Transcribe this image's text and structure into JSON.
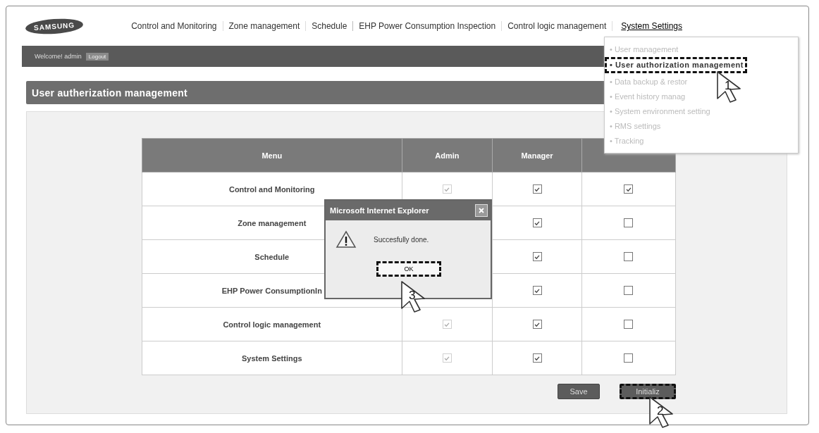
{
  "header": {
    "logo": "SAMSUNG",
    "nav": [
      {
        "label": "Control and Monitoring"
      },
      {
        "label": "Zone management"
      },
      {
        "label": "Schedule"
      },
      {
        "label": "EHP Power Consumption Inspection"
      },
      {
        "label": "Control logic management"
      },
      {
        "label": "System Settings",
        "expanded": true
      }
    ]
  },
  "user_bar": {
    "welcome": "Welcome! admin",
    "logout": "Logout"
  },
  "page_title": "User autherization management",
  "table": {
    "columns": [
      "Menu",
      "Admin",
      "Manager"
    ],
    "rows": [
      {
        "menu": "Control and Monitoring",
        "admin": {
          "checked": true,
          "disabled": true
        },
        "manager": {
          "checked": true,
          "disabled": false
        },
        "regular_user": {
          "checked": true,
          "disabled": false
        }
      },
      {
        "menu": "Zone management",
        "manager": {
          "checked": true,
          "disabled": false
        },
        "regular_user": {
          "checked": false,
          "disabled": false
        }
      },
      {
        "menu": "Schedule",
        "manager": {
          "checked": true,
          "disabled": false
        },
        "regular_user": {
          "checked": false,
          "disabled": false
        }
      },
      {
        "menu": "EHP Power ConsumptionIn",
        "manager": {
          "checked": true,
          "disabled": false
        },
        "regular_user": {
          "checked": false,
          "disabled": false
        }
      },
      {
        "menu": "Control logic management",
        "admin": {
          "checked": true,
          "disabled": true
        },
        "manager": {
          "checked": true,
          "disabled": false
        },
        "regular_user": {
          "checked": false,
          "disabled": false
        }
      },
      {
        "menu": "System Settings",
        "admin": {
          "checked": true,
          "disabled": true
        },
        "manager": {
          "checked": true,
          "disabled": false
        },
        "regular_user": {
          "checked": false,
          "disabled": false
        }
      }
    ]
  },
  "buttons": [
    {
      "label": "Save",
      "highlighted": false
    },
    {
      "label": "Initializ",
      "highlighted": true
    }
  ],
  "dropdown": {
    "items": [
      {
        "label": "• User management",
        "selected": false
      },
      {
        "label": "• User authorization management",
        "selected": true
      },
      {
        "label": "• Data backup & restor",
        "selected": false
      },
      {
        "label": "• Event history manag",
        "selected": false
      },
      {
        "label": "• System environment setting",
        "selected": false
      },
      {
        "label": "• RMS settings",
        "selected": false
      },
      {
        "label": "• Tracking",
        "selected": false
      }
    ]
  },
  "dialog": {
    "title": "Microsoft Internet Explorer",
    "message": "Succesfully done.",
    "button": {
      "label": "OK",
      "highlighted": true
    }
  },
  "steps": [
    {
      "number": "1"
    },
    {
      "number": "2"
    },
    {
      "number": "3"
    }
  ]
}
